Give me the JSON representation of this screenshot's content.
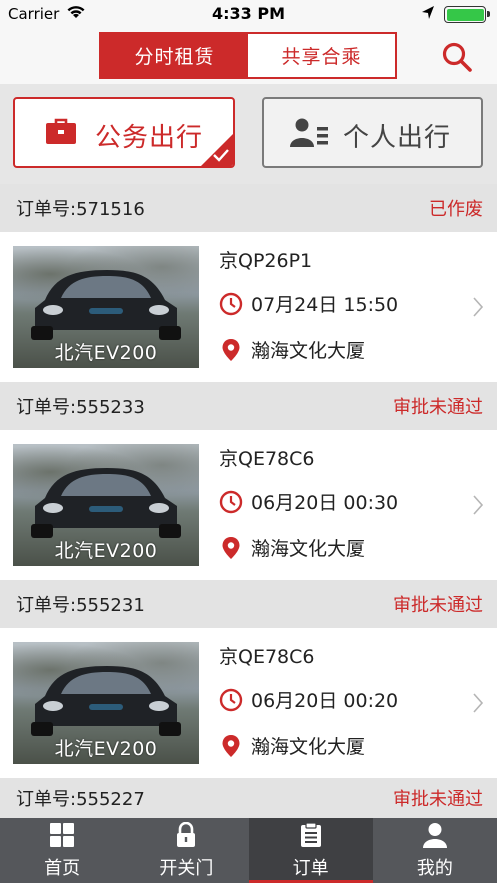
{
  "status_bar": {
    "carrier": "Carrier",
    "time": "4:33 PM",
    "battery_level": 1.0,
    "icons": [
      "wifi-icon",
      "location-arrow-icon",
      "battery-icon"
    ]
  },
  "header": {
    "tabs": [
      {
        "label": "分时租赁",
        "active": true
      },
      {
        "label": "共享合乘",
        "active": false
      }
    ],
    "search_icon": "search-icon",
    "accent_color": "#cc2a2a"
  },
  "travel_type": {
    "official": {
      "label": "公务出行",
      "icon": "briefcase-icon",
      "selected": true
    },
    "personal": {
      "label": "个人出行",
      "icon": "person-list-icon",
      "selected": false
    }
  },
  "orders": [
    {
      "order_no": "订单号:571516",
      "status": "已作废",
      "plate": "京QP26P1",
      "car_model": "北汽EV200",
      "datetime": "07月24日  15:50",
      "location": "瀚海文化大厦"
    },
    {
      "order_no": "订单号:555233",
      "status": "审批未通过",
      "plate": "京QE78C6",
      "car_model": "北汽EV200",
      "datetime": "06月20日  00:30",
      "location": "瀚海文化大厦"
    },
    {
      "order_no": "订单号:555231",
      "status": "审批未通过",
      "plate": "京QE78C6",
      "car_model": "北汽EV200",
      "datetime": "06月20日  00:20",
      "location": "瀚海文化大厦"
    },
    {
      "order_no": "订单号:555227",
      "status": "审批未通过"
    }
  ],
  "tabbar": [
    {
      "label": "首页",
      "icon": "grid-icon",
      "active": false
    },
    {
      "label": "开关门",
      "icon": "lock-icon",
      "active": false
    },
    {
      "label": "订单",
      "icon": "clipboard-icon",
      "active": true
    },
    {
      "label": "我的",
      "icon": "user-icon",
      "active": false
    }
  ]
}
